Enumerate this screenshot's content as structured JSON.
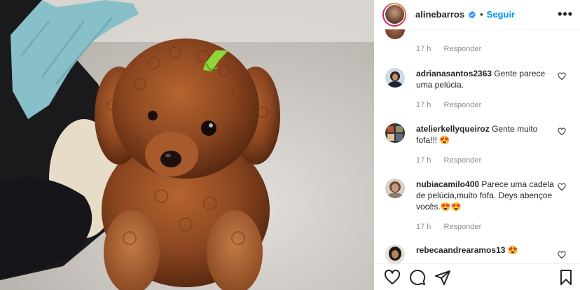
{
  "header": {
    "username": "alinebarros",
    "separator": "•",
    "follow_label": "Seguir",
    "more_label": "•••"
  },
  "top_partial": {
    "time": "17 h",
    "reply": "Responder"
  },
  "comments": [
    {
      "username": "adrianasantos2363",
      "text": "Gente parece uma pelúcia.",
      "time": "17 h",
      "reply": "Responder"
    },
    {
      "username": "atelierkellyqueiroz",
      "text": "Gente muito fofa!!! 😍",
      "time": "17 h",
      "reply": "Responder"
    },
    {
      "username": "nubiacamilo400",
      "text": "Parece uma cadela de pelúcia,muito fofa. Deys abençoe vocês.😍😍",
      "time": "17 h",
      "reply": "Responder"
    },
    {
      "username": "rebecaandrearamos13",
      "text": "😍",
      "time": "",
      "reply": ""
    }
  ],
  "colors": {
    "follow": "#0095f6",
    "verified": "#3897f0",
    "meta": "#8e8e8e",
    "text": "#262626"
  },
  "icons": {
    "like": "heart-icon",
    "comment": "comment-icon",
    "share": "paper-plane-icon",
    "save": "bookmark-icon",
    "verified": "verified-badge-icon",
    "more": "more-options-icon"
  }
}
